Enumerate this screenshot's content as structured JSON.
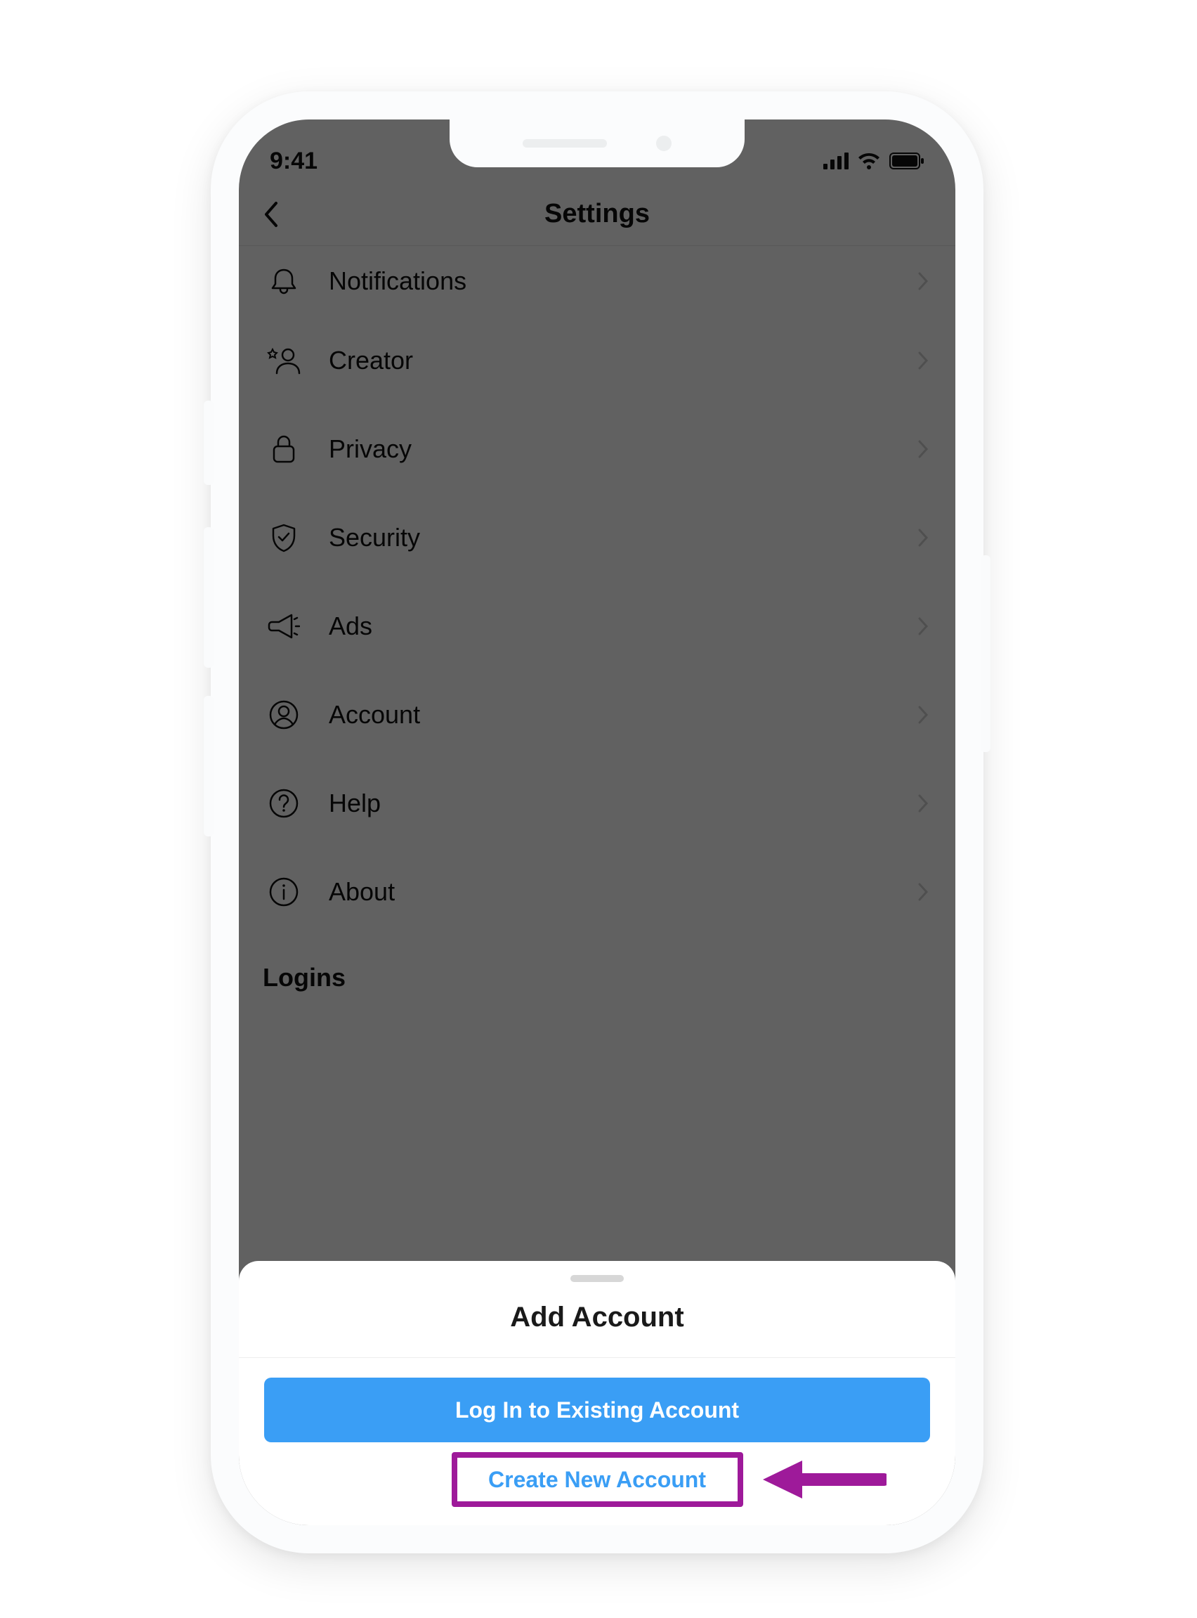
{
  "status_bar": {
    "time": "9:41"
  },
  "nav": {
    "title": "Settings"
  },
  "settings": {
    "items": [
      {
        "icon": "bell-icon",
        "label": "Notifications"
      },
      {
        "icon": "creator-icon",
        "label": "Creator"
      },
      {
        "icon": "lock-icon",
        "label": "Privacy"
      },
      {
        "icon": "shield-check-icon",
        "label": "Security"
      },
      {
        "icon": "megaphone-icon",
        "label": "Ads"
      },
      {
        "icon": "user-circle-icon",
        "label": "Account"
      },
      {
        "icon": "help-circle-icon",
        "label": "Help"
      },
      {
        "icon": "info-circle-icon",
        "label": "About"
      }
    ],
    "section_header": "Logins"
  },
  "sheet": {
    "title": "Add Account",
    "primary_button": "Log In to Existing Account",
    "secondary_link": "Create New Account"
  },
  "annotation": {
    "highlight_color": "#9e1a9a",
    "arrow_color": "#9e1a9a"
  }
}
